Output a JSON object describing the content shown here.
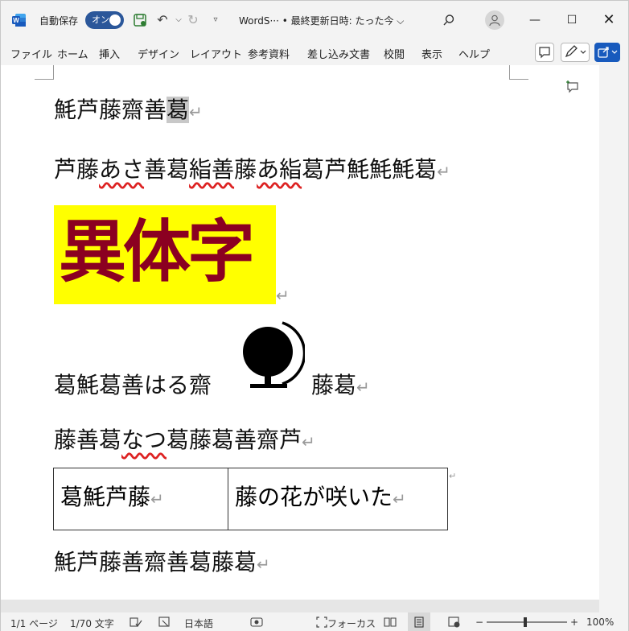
{
  "titlebar": {
    "autosave_label": "自動保存",
    "autosave_state": "オン",
    "doc_title": "WordS··· • 最終更新日時: たった今 ⌵",
    "icons": [
      "word-logo-icon",
      "save-icon",
      "undo-icon",
      "redo-icon",
      "customize-icon",
      "search-icon",
      "account-icon",
      "minimize-icon",
      "maximize-icon",
      "close-icon"
    ]
  },
  "ribbon": {
    "tabs": [
      "ファイル",
      "ホーム",
      "挿入",
      "デザイン",
      "レイアウト",
      "参考資料",
      "差し込み文書",
      "校閲",
      "表示",
      "ヘルプ"
    ]
  },
  "document": {
    "para1_main": "魹芦藤齋善",
    "para1_sel": "葛",
    "para2_a": "芦藤",
    "para2_b": "あさ",
    "para2_c": "善葛",
    "para2_d": "𥿻善",
    "para2_e": "藤",
    "para2_f": "あ𥿻",
    "para2_g": "葛芦魹魹魹葛",
    "banner_text": "異体字",
    "para4_left": "葛魹葛善はる齋",
    "para4_right": "藤葛",
    "para5_a": "藤善葛",
    "para5_b": "なつ",
    "para5_c": "葛藤葛善齋芦",
    "table_cell1": "葛魹芦藤",
    "table_cell2": "藤の花が咲いた",
    "para_last": "魹芦藤善齋善葛藤葛",
    "return_mark": "↵"
  },
  "statusbar": {
    "page": "1/1 ページ",
    "words": "1/70 文字",
    "language": "日本語",
    "focus": "フォーカス",
    "zoom": "100%",
    "zoom_minus": "−",
    "zoom_plus": "+"
  },
  "colors": {
    "accent": "#2b579a",
    "banner_bg": "#ffff00",
    "banner_text": "#8b0021"
  }
}
